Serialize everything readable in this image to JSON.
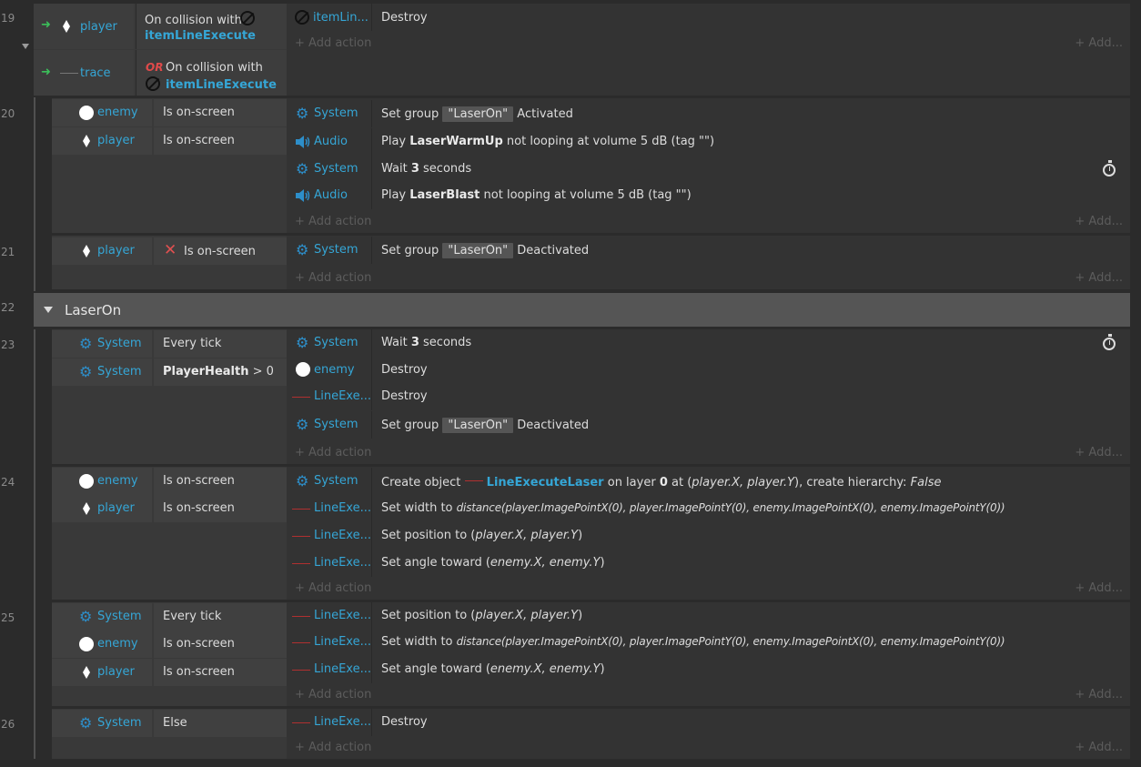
{
  "event19": {
    "number": "19",
    "cond1_obj": "player",
    "cond1_text": "On collision with",
    "cond1_link": "itemLineExecute",
    "cond2_obj": "trace",
    "cond2_or": "OR",
    "cond2_text": "On collision with",
    "cond2_link": "itemLineExecute",
    "action1_obj": "itemLin...",
    "action1_text": "Destroy"
  },
  "event20": {
    "number": "20",
    "cond1_obj": "enemy",
    "cond1_text": "Is on-screen",
    "cond2_obj": "player",
    "cond2_text": "Is on-screen",
    "a1_obj": "System",
    "a1_pre": "Set group",
    "a1_group": "\"LaserOn\"",
    "a1_post": "Activated",
    "a2_obj": "Audio",
    "a2_pre": "Play",
    "a2_bold": "LaserWarmUp",
    "a2_post": "not looping at volume 5 dB (tag  \"\")",
    "a3_obj": "System",
    "a3_pre": "Wait",
    "a3_bold": "3",
    "a3_post": "seconds",
    "a4_obj": "Audio",
    "a4_pre": "Play",
    "a4_bold": "LaserBlast",
    "a4_post": "not looping at volume 5 dB (tag  \"\")"
  },
  "event21": {
    "number": "21",
    "cond1_obj": "player",
    "cond1_text": "Is on-screen",
    "a1_obj": "System",
    "a1_pre": "Set group",
    "a1_group": "\"LaserOn\"",
    "a1_post": "Deactivated"
  },
  "group22": {
    "number": "22",
    "name": "LaserOn"
  },
  "event23": {
    "number": "23",
    "cond1_obj": "System",
    "cond1_text": "Every tick",
    "cond2_obj": "System",
    "cond2_bold": "PlayerHealth",
    "cond2_post": "> 0",
    "a1_obj": "System",
    "a1_pre": "Wait",
    "a1_bold": "3",
    "a1_post": "seconds",
    "a2_obj": "enemy",
    "a2_text": "Destroy",
    "a3_obj": "LineExe...",
    "a3_text": "Destroy",
    "a4_obj": "System",
    "a4_pre": "Set group",
    "a4_group": "\"LaserOn\"",
    "a4_post": "Deactivated"
  },
  "event24": {
    "number": "24",
    "cond1_obj": "enemy",
    "cond1_text": "Is on-screen",
    "cond2_obj": "player",
    "cond2_text": "Is on-screen",
    "a1_obj": "System",
    "a1_pre": "Create object",
    "a1_link": "LineExecuteLaser",
    "a1_mid": "on layer",
    "a1_bold": "0",
    "a1_at": "at (",
    "a1_it1": "player.X,  player.Y",
    "a1_post": "), create hierarchy:",
    "a1_it2": "False",
    "a2_obj": "LineExe...",
    "a2_pre": "Set width to",
    "a2_it": "distance(player.ImagePointX(0), player.ImagePointY(0), enemy.ImagePointX(0), enemy.ImagePointY(0))",
    "a3_obj": "LineExe...",
    "a3_pre": "Set position to (",
    "a3_it": "player.X,  player.Y",
    "a3_post": ")",
    "a4_obj": "LineExe...",
    "a4_pre": "Set angle toward (",
    "a4_it": "enemy.X,  enemy.Y",
    "a4_post": ")"
  },
  "event25": {
    "number": "25",
    "cond1_obj": "System",
    "cond1_text": "Every tick",
    "cond2_obj": "enemy",
    "cond2_text": "Is on-screen",
    "cond3_obj": "player",
    "cond3_text": "Is on-screen",
    "a1_obj": "LineExe...",
    "a1_pre": "Set position to (",
    "a1_it": "player.X,  player.Y",
    "a1_post": ")",
    "a2_obj": "LineExe...",
    "a2_pre": "Set width to",
    "a2_it": "distance(player.ImagePointX(0), player.ImagePointY(0), enemy.ImagePointX(0), enemy.ImagePointY(0))",
    "a3_obj": "LineExe...",
    "a3_pre": "Set angle toward (",
    "a3_it": "enemy.X,  enemy.Y",
    "a3_post": ")"
  },
  "event26": {
    "number": "26",
    "cond1_obj": "System",
    "cond1_text": "Else",
    "a1_obj": "LineExe...",
    "a1_text": "Destroy"
  },
  "common": {
    "add_action": "+ Add action",
    "add_more": "+ Add..."
  }
}
